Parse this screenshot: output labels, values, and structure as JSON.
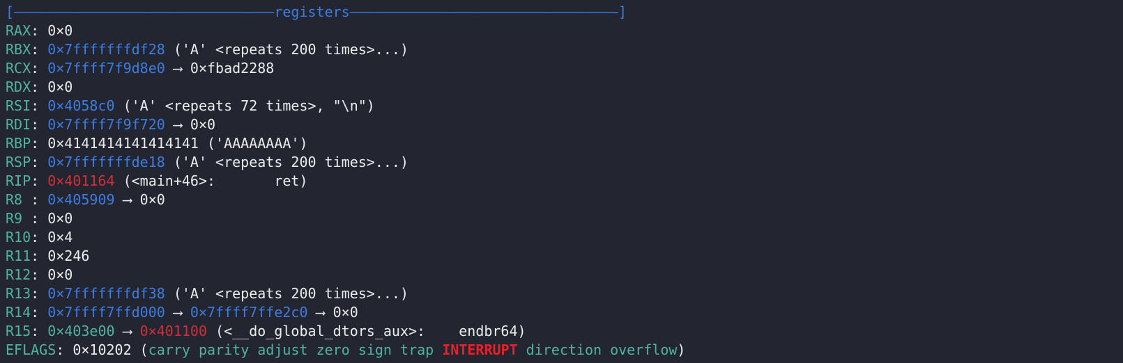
{
  "header": {
    "left": "[",
    "rule": "———————————————————————————————",
    "title": "registers",
    "rule2": "————————————————————————————————",
    "right": "]"
  },
  "registers": [
    {
      "name": "RAX",
      "sep": ": ",
      "parts": [
        {
          "t": "0×0",
          "c": "white"
        }
      ]
    },
    {
      "name": "RBX",
      "sep": ": ",
      "parts": [
        {
          "t": "0×7fffffffdf28",
          "c": "addr"
        },
        {
          "t": " ('A' <repeats 200 times>...)",
          "c": "white"
        }
      ]
    },
    {
      "name": "RCX",
      "sep": ": ",
      "parts": [
        {
          "t": "0×7ffff7f9d8e0",
          "c": "addr"
        },
        {
          "t": " ⟶ 0×fbad2288",
          "c": "white"
        }
      ]
    },
    {
      "name": "RDX",
      "sep": ": ",
      "parts": [
        {
          "t": "0×0",
          "c": "white"
        }
      ]
    },
    {
      "name": "RSI",
      "sep": ": ",
      "parts": [
        {
          "t": "0×4058c0",
          "c": "addr"
        },
        {
          "t": " ('A' <repeats 72 times>, \"\\n\")",
          "c": "white"
        }
      ]
    },
    {
      "name": "RDI",
      "sep": ": ",
      "parts": [
        {
          "t": "0×7ffff7f9f720",
          "c": "addr"
        },
        {
          "t": " ⟶ 0×0",
          "c": "white"
        }
      ]
    },
    {
      "name": "RBP",
      "sep": ": ",
      "parts": [
        {
          "t": "0×4141414141414141 ('AAAAAAAA')",
          "c": "white"
        }
      ]
    },
    {
      "name": "RSP",
      "sep": ": ",
      "parts": [
        {
          "t": "0×7fffffffde18",
          "c": "addr"
        },
        {
          "t": " ('A' <repeats 200 times>...)",
          "c": "white"
        }
      ]
    },
    {
      "name": "RIP",
      "sep": ": ",
      "parts": [
        {
          "t": "0×401164",
          "c": "code"
        },
        {
          "t": " (<main+46>:       ret)",
          "c": "white"
        }
      ]
    },
    {
      "name": "R8 ",
      "sep": ": ",
      "parts": [
        {
          "t": "0×405909",
          "c": "addr"
        },
        {
          "t": " ⟶ 0×0",
          "c": "white"
        }
      ]
    },
    {
      "name": "R9 ",
      "sep": ": ",
      "parts": [
        {
          "t": "0×0",
          "c": "white"
        }
      ]
    },
    {
      "name": "R10",
      "sep": ": ",
      "parts": [
        {
          "t": "0×4",
          "c": "white"
        }
      ]
    },
    {
      "name": "R11",
      "sep": ": ",
      "parts": [
        {
          "t": "0×246",
          "c": "white"
        }
      ]
    },
    {
      "name": "R12",
      "sep": ": ",
      "parts": [
        {
          "t": "0×0",
          "c": "white"
        }
      ]
    },
    {
      "name": "R13",
      "sep": ": ",
      "parts": [
        {
          "t": "0×7fffffffdf38",
          "c": "addr"
        },
        {
          "t": " ('A' <repeats 200 times>...)",
          "c": "white"
        }
      ]
    },
    {
      "name": "R14",
      "sep": ": ",
      "parts": [
        {
          "t": "0×7ffff7ffd000",
          "c": "addr"
        },
        {
          "t": " ⟶ ",
          "c": "white"
        },
        {
          "t": "0×7ffff7ffe2c0",
          "c": "addr"
        },
        {
          "t": " ⟶ 0×0",
          "c": "white"
        }
      ]
    },
    {
      "name": "R15",
      "sep": ": ",
      "parts": [
        {
          "t": "0×403e00",
          "c": "lbl"
        },
        {
          "t": " ⟶ ",
          "c": "white"
        },
        {
          "t": "0×401100",
          "c": "code"
        },
        {
          "t": " (<__do_global_dtors_aux>:    endbr64)",
          "c": "white"
        }
      ]
    }
  ],
  "eflags": {
    "name": "EFLAGS",
    "value": "0×10202",
    "flags": [
      {
        "t": "carry",
        "on": false
      },
      {
        "t": "parity",
        "on": false
      },
      {
        "t": "adjust",
        "on": false
      },
      {
        "t": "zero",
        "on": false
      },
      {
        "t": "sign",
        "on": false
      },
      {
        "t": "trap",
        "on": false
      },
      {
        "t": "INTERRUPT",
        "on": true
      },
      {
        "t": "direction",
        "on": false
      },
      {
        "t": "overflow",
        "on": false
      }
    ]
  },
  "colors": {
    "background": "#232530",
    "address": "#3d7ce0",
    "code": "#d0303a",
    "label": "#4fb3a3",
    "text": "#ececec"
  }
}
